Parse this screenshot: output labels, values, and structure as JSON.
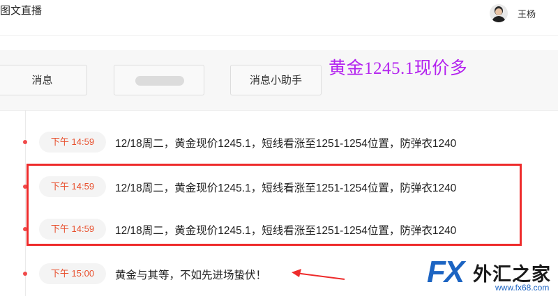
{
  "header": {
    "app_title": "图文直播",
    "user_name": "王杨"
  },
  "tabs": [
    {
      "label": "消息"
    },
    {
      "label": ""
    },
    {
      "label": "消息小助手"
    }
  ],
  "headline": "黄金1245.1现价多",
  "entries": [
    {
      "time": "下午 14:59",
      "text": "12/18周二，黄金现价1245.1，短线看涨至1251-1254位置，防弹衣1240"
    },
    {
      "time": "下午 14:59",
      "text": "12/18周二，黄金现价1245.1，短线看涨至1251-1254位置，防弹衣1240"
    },
    {
      "time": "下午 14:59",
      "text": "12/18周二，黄金现价1245.1，短线看涨至1251-1254位置，防弹衣1240"
    },
    {
      "time": "下午 15:00",
      "text": "黄金与其等，不如先进场蛰伏！"
    }
  ],
  "watermark": {
    "brand": "FX",
    "name": "外汇之家",
    "url": "www.fx68.com"
  },
  "colors": {
    "accent_red": "#ee2b2b",
    "time_text": "#e8502e",
    "headline": "#b322ef",
    "watermark_blue": "#1c64c2"
  }
}
